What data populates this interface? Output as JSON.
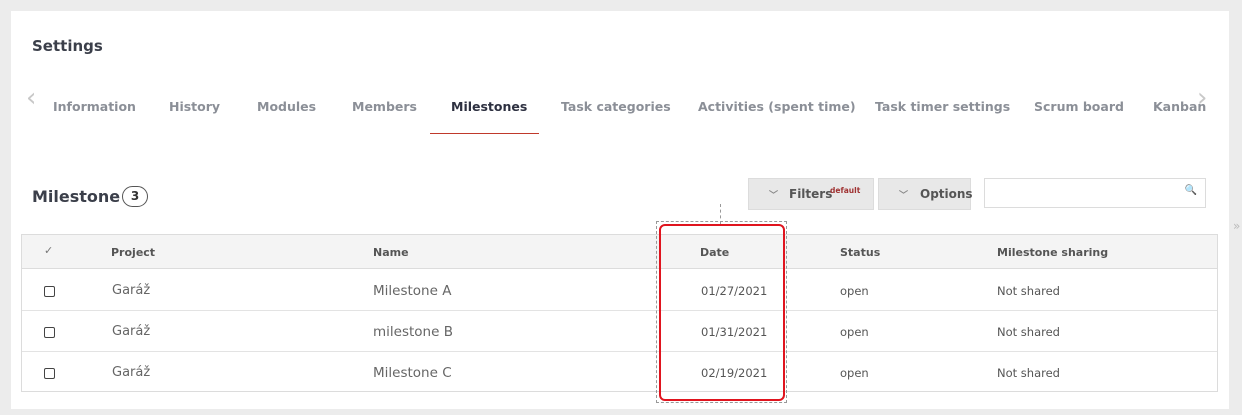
{
  "page": {
    "title": "Settings"
  },
  "tabs": [
    {
      "label": "Information"
    },
    {
      "label": "History"
    },
    {
      "label": "Modules"
    },
    {
      "label": "Members"
    },
    {
      "label": "Milestones"
    },
    {
      "label": "Task categories"
    },
    {
      "label": "Activities (spent time)"
    },
    {
      "label": "Task timer settings"
    },
    {
      "label": "Scrum board"
    },
    {
      "label": "Kanban"
    }
  ],
  "active_tab": "Milestones",
  "section": {
    "title": "Milestone",
    "count": "3"
  },
  "toolbar": {
    "filters_label": "Filters",
    "filters_badge": "default",
    "options_label": "Options",
    "search_value": ""
  },
  "table": {
    "headers": {
      "check": "✓",
      "project": "Project",
      "name": "Name",
      "date": "Date",
      "status": "Status",
      "sharing": "Milestone sharing"
    },
    "rows": [
      {
        "project": "Garáž",
        "name": "Milestone A",
        "date": "01/27/2021",
        "status": "open",
        "sharing": "Not shared"
      },
      {
        "project": "Garáž",
        "name": "milestone B",
        "date": "01/31/2021",
        "status": "open",
        "sharing": "Not shared"
      },
      {
        "project": "Garáž",
        "name": "Milestone C",
        "date": "02/19/2021",
        "status": "open",
        "sharing": "Not shared"
      }
    ]
  },
  "icons": {
    "prev": "chevron-left-icon",
    "next": "chevron-right-icon",
    "search": "search-icon",
    "collapse": "double-chevron-right-icon"
  },
  "colors": {
    "accent": "#c0392b",
    "highlight": "#e0141e"
  }
}
